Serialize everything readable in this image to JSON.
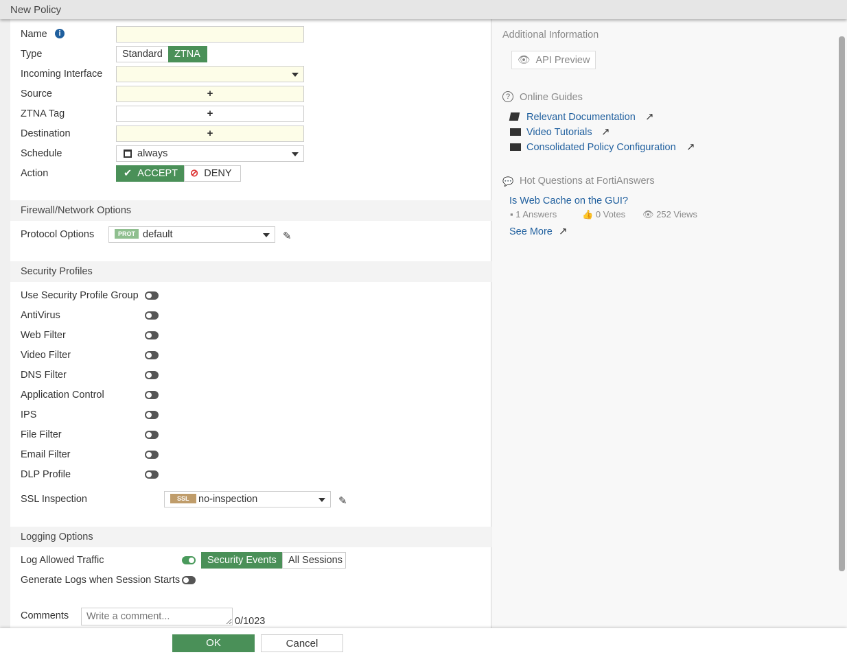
{
  "title": "New Policy",
  "form": {
    "name_label": "Name",
    "type_label": "Type",
    "type_options": [
      "Standard",
      "ZTNA"
    ],
    "incoming_label": "Incoming Interface",
    "source_label": "Source",
    "ztna_tag_label": "ZTNA Tag",
    "destination_label": "Destination",
    "schedule_label": "Schedule",
    "schedule_value": "always",
    "action_label": "Action",
    "accept": "ACCEPT",
    "deny": "DENY",
    "plus": "+"
  },
  "firewall": {
    "header": "Firewall/Network Options",
    "protocol_label": "Protocol Options",
    "protocol_badge": "PROT",
    "protocol_value": "default"
  },
  "security": {
    "header": "Security Profiles",
    "items": [
      "Use Security Profile Group",
      "AntiVirus",
      "Web Filter",
      "Video Filter",
      "DNS Filter",
      "Application Control",
      "IPS",
      "File Filter",
      "Email Filter",
      "DLP Profile"
    ],
    "ssl_label": "SSL Inspection",
    "ssl_badge": "SSL",
    "ssl_value": "no-inspection"
  },
  "logging": {
    "header": "Logging Options",
    "log_allowed": "Log Allowed Traffic",
    "options": [
      "Security Events",
      "All Sessions"
    ],
    "gen_logs": "Generate Logs when Session Starts"
  },
  "comments": {
    "label": "Comments",
    "placeholder": "Write a comment...",
    "count": "0/1023"
  },
  "footer": {
    "ok": "OK",
    "cancel": "Cancel"
  },
  "sidebar": {
    "header": "Additional Information",
    "api_preview": "API Preview",
    "guides_header": "Online Guides",
    "guides": [
      "Relevant Documentation",
      "Video Tutorials",
      "Consolidated Policy Configuration"
    ],
    "hot_header": "Hot Questions at FortiAnswers",
    "question": "Is Web Cache on the GUI?",
    "answers": "1 Answers",
    "votes": "0 Votes",
    "views": "252 Views",
    "see_more": "See More"
  }
}
